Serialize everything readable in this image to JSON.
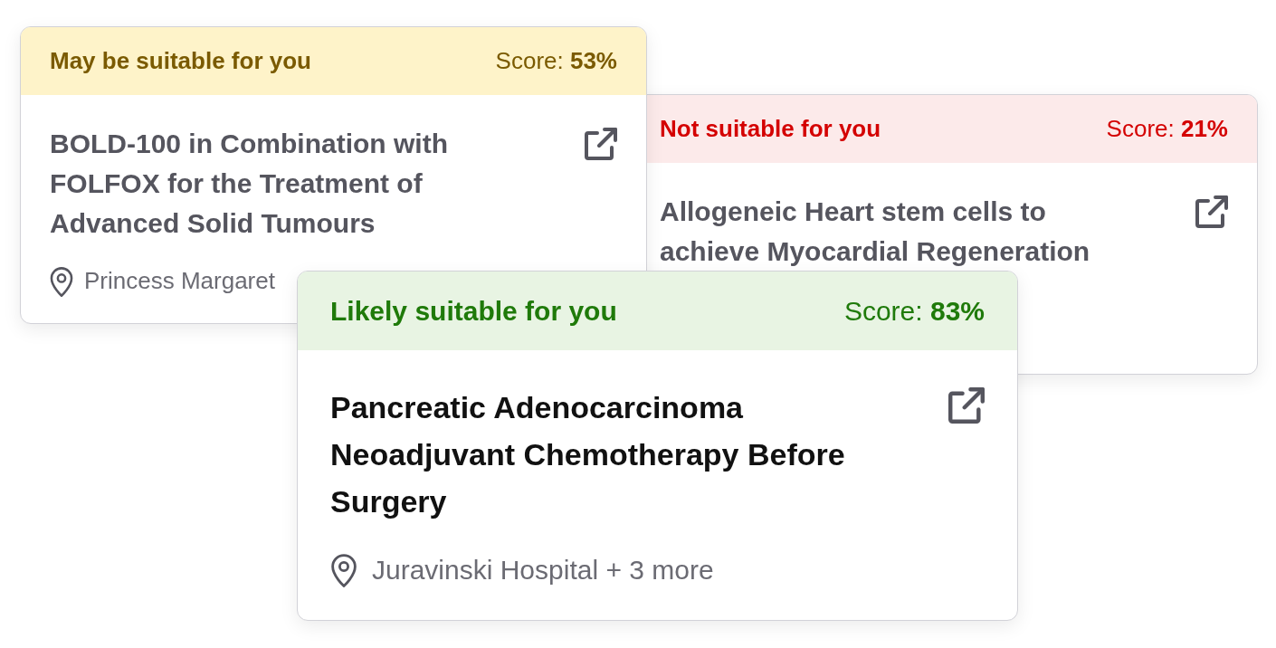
{
  "cards": [
    {
      "kind": "maybe",
      "highlighted": false,
      "verdict": "May be suitable for you",
      "score": "Score: **53%**",
      "title": "BOLD-100 in Combination with FOLFOX for the Treatment of Advanced Solid Tumours",
      "location": "Princess Margaret"
    },
    {
      "kind": "unsuitable",
      "highlighted": false,
      "verdict": "Not suitable for you",
      "score": "Score: **21%**",
      "title": "Allogeneic Heart stem cells to achieve Myocardial Regeneration"
    },
    {
      "kind": "likely",
      "highlighted": true,
      "verdict": "Likely suitable for you",
      "score": "Score: **83%**",
      "title": "Pancreatic Adenocarcinoma Neoadjuvant Chemotherapy Before Surgery",
      "location": "Juravinski Hospital + 3 more"
    }
  ]
}
